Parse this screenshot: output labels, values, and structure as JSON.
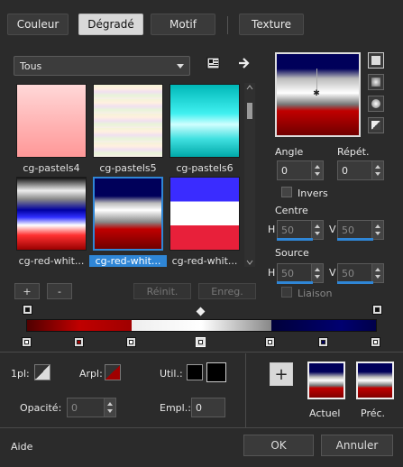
{
  "tabs": [
    {
      "label": "Couleur",
      "active": false
    },
    {
      "label": "Dégradé",
      "active": true
    },
    {
      "label": "Motif",
      "active": false
    },
    {
      "label": "Texture",
      "active": false
    }
  ],
  "category": {
    "selected": "Tous"
  },
  "presets": [
    {
      "label": "cg-pastels4",
      "selected": false
    },
    {
      "label": "cg-pastels5",
      "selected": false
    },
    {
      "label": "cg-pastels6",
      "selected": false
    },
    {
      "label": "cg-red-whit...",
      "selected": false
    },
    {
      "label": "cg-red-whit...",
      "selected": true
    },
    {
      "label": "cg-red-whit...",
      "selected": false
    }
  ],
  "buttons": {
    "add": "+",
    "remove": "-",
    "reset": "Réinit.",
    "save": "Enreg.",
    "ok": "OK",
    "cancel": "Annuler",
    "add_swatch": "+"
  },
  "angle": {
    "label": "Angle",
    "value": "0"
  },
  "repeat": {
    "label": "Répét.",
    "value": "0"
  },
  "invert": {
    "label": "Invers",
    "checked": false
  },
  "center": {
    "label": "Centre",
    "h_label": "H",
    "h_value": "50",
    "v_label": "V",
    "v_value": "50"
  },
  "source": {
    "label": "Source",
    "h_label": "H",
    "h_value": "50",
    "v_label": "V",
    "v_value": "50"
  },
  "link": {
    "label": "Liaison",
    "checked": false
  },
  "bottom": {
    "first_label": "1pl:",
    "back_label": "Arpl:",
    "util_label": "Util.:",
    "opacity_label": "Opacité:",
    "opacity_value": "0",
    "location_label": "Empl.:",
    "location_value": "0",
    "current_label": "Actuel",
    "previous_label": "Préc."
  },
  "help": "Aide",
  "colors": {
    "accent": "#2f86d6",
    "navy": "#00005a",
    "red": "#a00000",
    "white": "#f0f0f0"
  }
}
